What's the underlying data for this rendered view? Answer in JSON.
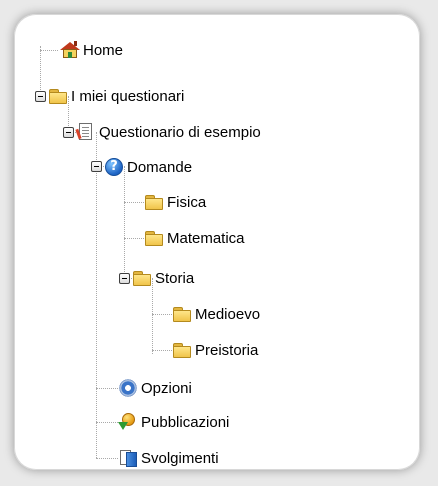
{
  "tree": {
    "home": {
      "label": "Home",
      "icon": "home-icon"
    },
    "miei_questionari": {
      "label": "I miei questionari",
      "icon": "folder-icon"
    },
    "questionario": {
      "label": "Questionario di esempio",
      "icon": "document-icon"
    },
    "domande": {
      "label": "Domande",
      "icon": "help-icon"
    },
    "fisica": {
      "label": "Fisica",
      "icon": "folder-icon"
    },
    "matematica": {
      "label": "Matematica",
      "icon": "folder-icon"
    },
    "storia": {
      "label": "Storia",
      "icon": "folder-icon"
    },
    "medioevo": {
      "label": "Medioevo",
      "icon": "folder-icon"
    },
    "preistoria": {
      "label": "Preistoria",
      "icon": "folder-icon"
    },
    "opzioni": {
      "label": "Opzioni",
      "icon": "gear-icon"
    },
    "pubblicazioni": {
      "label": "Pubblicazioni",
      "icon": "publish-icon"
    },
    "svolgimenti": {
      "label": "Svolgimenti",
      "icon": "submissions-icon"
    }
  }
}
